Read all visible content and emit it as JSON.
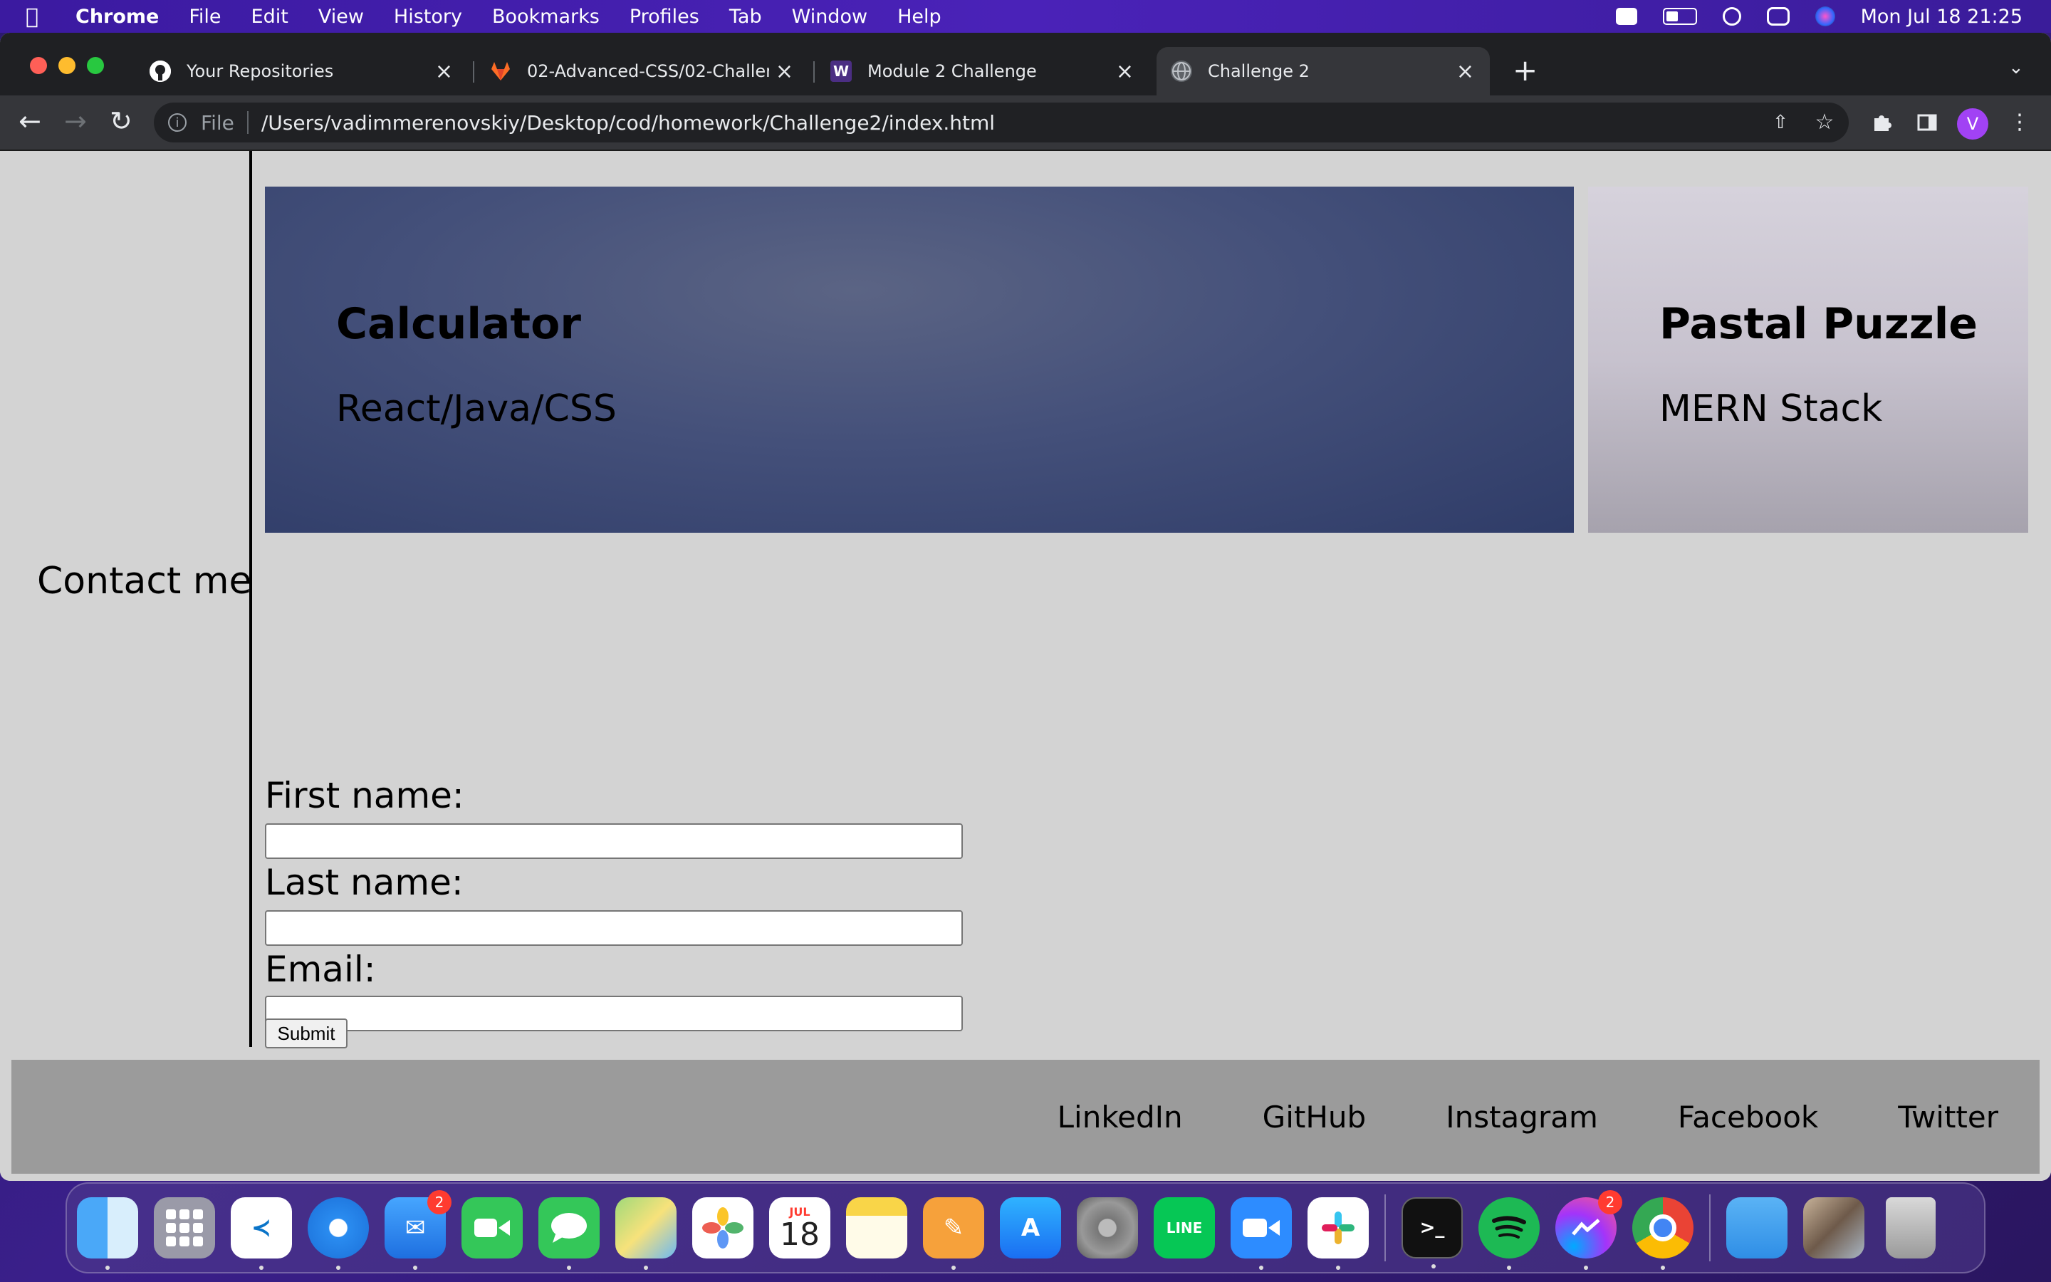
{
  "menubar": {
    "app_name": "Chrome",
    "items": [
      "File",
      "Edit",
      "View",
      "History",
      "Bookmarks",
      "Profiles",
      "Tab",
      "Window",
      "Help"
    ],
    "clock": "Mon Jul 18  21:25"
  },
  "tabs": [
    {
      "title": "Your Repositories",
      "icon": "github-icon"
    },
    {
      "title": "02-Advanced-CSS/02-Challenge",
      "icon": "gitlab-icon"
    },
    {
      "title": "Module 2 Challenge",
      "icon": "w-icon",
      "icon_text": "W"
    },
    {
      "title": "Challenge 2",
      "icon": "globe-icon",
      "active": true
    }
  ],
  "omnibox": {
    "scheme": "File",
    "url": "/Users/vadimmerenovskiy/Desktop/cod/homework/Challenge2/index.html"
  },
  "profile_initial": "V",
  "page": {
    "contact_heading": "Contact me",
    "projects": [
      {
        "title": "Calculator",
        "subtitle": "React/Java/CSS"
      },
      {
        "title": "Pastal Puzzle",
        "subtitle": "MERN Stack"
      }
    ],
    "form": {
      "first_name_label": "First name:",
      "last_name_label": "Last name:",
      "email_label": "Email:",
      "first_name_value": "",
      "last_name_value": "",
      "email_value": "",
      "submit_label": "Submit"
    },
    "footer_links": [
      "LinkedIn",
      "GitHub",
      "Instagram",
      "Facebook",
      "Twitter"
    ]
  },
  "dock": {
    "mail_badge": "2",
    "messenger_badge": "2",
    "calendar_month": "JUL",
    "calendar_day": "18"
  },
  "colors": {
    "page_bg": "#d3d3d3",
    "footer_bg": "#9b9b9b",
    "chrome_dark": "#1f2023",
    "chrome_toolbar": "#35363a"
  }
}
